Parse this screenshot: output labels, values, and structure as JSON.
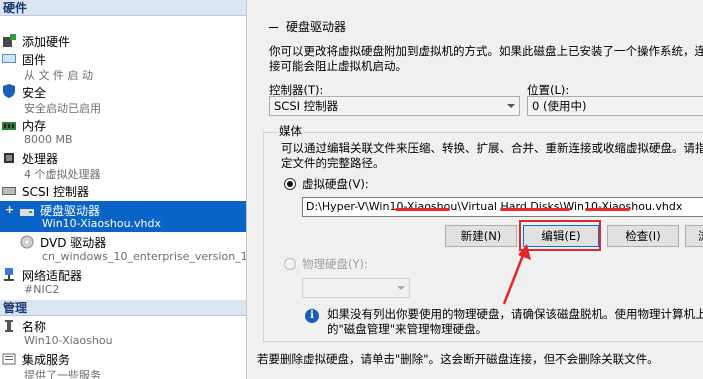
{
  "left": {
    "hardware_header": "硬件",
    "management_header": "管理",
    "items": [
      {
        "label": "添加硬件",
        "sub": ""
      },
      {
        "label": "固件",
        "sub": "从 文 件 启 动"
      },
      {
        "label": "安全",
        "sub": "安全启动已启用"
      },
      {
        "label": "内存",
        "sub": "8000 MB"
      },
      {
        "label": "处理器",
        "sub": "4 个虚拟处理器"
      },
      {
        "label": "SCSI 控制器",
        "sub": ""
      },
      {
        "label": "硬盘驱动器",
        "sub": "Win10-Xiaoshou.vhdx"
      },
      {
        "label": "DVD 驱动器",
        "sub": "cn_windows_10_enterprise_version_1..."
      },
      {
        "label": "网络适配器",
        "sub": "#NIC2"
      }
    ],
    "mgmt_items": [
      {
        "label": "名称",
        "sub": "Win10-Xiaoshou"
      },
      {
        "label": "集成服务",
        "sub": "提供了一些服务"
      }
    ]
  },
  "right": {
    "title": "硬盘驱动器",
    "description": "你可以更改将虚拟硬盘附加到虚拟机的方式。如果此磁盘上已安装了一个操作系统，连接可能会阻止虚拟机启动。",
    "controller_label": "控制器(T):",
    "controller_value": "SCSI 控制器",
    "location_label": "位置(L):",
    "location_value": "0 (使用中)",
    "media_label": "媒体",
    "media_desc": "可以通过编辑关联文件来压缩、转换、扩展、合并、重新连接或收缩虚拟硬盘。请指定文件的完整路径。",
    "vhd_radio_label": "虚拟硬盘(V):",
    "vhd_path": "D:\\Hyper-V\\Win10-Xiaoshou\\Virtual Hard Disks\\Win10-Xiaoshou.vhdx",
    "buttons": {
      "new": "新建(N)",
      "edit": "编辑(E)",
      "inspect": "检查(I)",
      "browse": "浏"
    },
    "physical_radio_label": "物理硬盘(Y):",
    "info_text": "如果没有列出你要使用的物理硬盘，请确保该磁盘脱机。使用物理计算机上的\"磁盘管理\"来管理物理硬盘。",
    "footer_text": "若要删除虚拟硬盘，请单击\"删除\"。这会断开磁盘连接，但不会删除关联文件。"
  },
  "colors": {
    "selection": "#0a64c8",
    "highlight": "#e0282a",
    "section_bg": "#dbe4f1"
  }
}
